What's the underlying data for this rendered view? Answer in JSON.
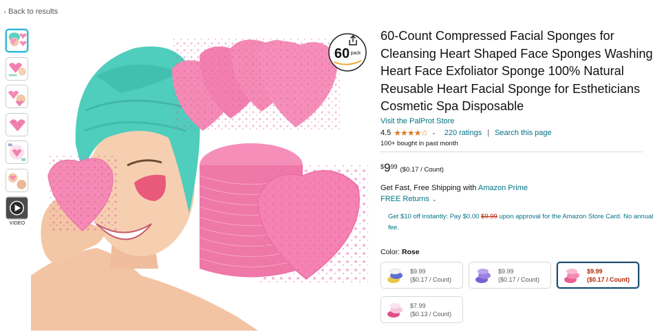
{
  "nav": {
    "back_label": "Back to results"
  },
  "gallery": {
    "video_label": "VIDEO",
    "main_image_alt": "Woman in teal towel holding pink heart sponge with stacks of pink heart sponges",
    "badge": {
      "number": "60",
      "word": "pack"
    }
  },
  "product": {
    "title": "60-Count Compressed Facial Sponges for Cleansing Heart Shaped Face Sponges Washing Heart Face Exfoliator Sponge 100% Natural Reusable Heart Facial Sponge for Estheticians Cosmetic Spa Disposable",
    "store_link": "Visit the PalProt Store",
    "rating_value": "4.5",
    "stars": "★★★★☆",
    "ratings_count": "220 ratings",
    "search_link": "Search this page",
    "bought": "100+ bought in past month",
    "price": {
      "symbol": "$",
      "whole": "9",
      "fraction": "99",
      "unit": "($0.17 / Count)"
    },
    "shipping_prefix": "Get ",
    "shipping_bold": "Fast, Free Shipping",
    "shipping_mid": " with ",
    "prime_link": "Amazon Prime",
    "returns": "FREE Returns",
    "card_offer_a": "Get $10 off instantly: Pay $0.00 ",
    "card_offer_strike": "$9.99",
    "card_offer_b": " upon approval for the Amazon Store Card. No annual fee.",
    "color_label": "Color: ",
    "color_value": "Rose"
  },
  "swatches": [
    {
      "price": "$9.99",
      "unit": "($0.17 / Count)",
      "colors": [
        "#e8c84a",
        "#5b6fd6",
        "#f2f2f2"
      ]
    },
    {
      "price": "$9.99",
      "unit": "($0.17 / Count)",
      "colors": [
        "#7a5fd0",
        "#9a82e0",
        "#b9a5ec"
      ]
    },
    {
      "price": "$9.99",
      "unit": "($0.17 / Count)",
      "colors": [
        "#e85f93",
        "#f48ab2",
        "#f9b8cf"
      ]
    },
    {
      "price": "$7.99",
      "unit": "($0.13 / Count)",
      "colors": [
        "#e04d8a",
        "#f6c6da",
        "#fbe3ee"
      ]
    }
  ]
}
